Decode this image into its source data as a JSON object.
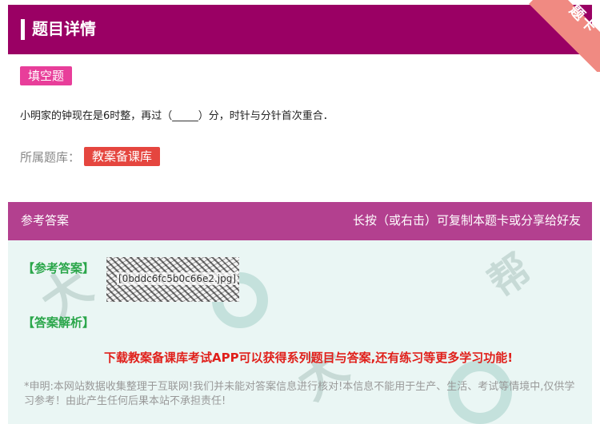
{
  "header": {
    "title": "题目详情"
  },
  "ribbon": {
    "text": "题卡"
  },
  "question": {
    "type_badge": "填空题",
    "text": "小明家的钟现在是6时整，再过（_____）分，时针与分针首次重合．",
    "bank_label": "所属题库：",
    "bank_name": "教案备课库"
  },
  "answer_bar": {
    "left_label": "参考答案",
    "right_label": "长按（或右击）可复制本题卡或分享给好友"
  },
  "answer": {
    "answer_label": "【参考答案】",
    "image_alt": "[0bddc6fc5b0c66e2.jpg]",
    "analysis_label": "【答案解析】",
    "promo": "下载教案备课库考试APP可以获得系列题目与答案,还有练习等更多学习功能!",
    "disclaimer": "*申明:本网站数据收集整理于互联网!我们并未能对答案信息进行核对!本信息不能用于生产、生活、考试等情境中,仅供学习参考！由此产生任何后果本站不承担责任!"
  }
}
